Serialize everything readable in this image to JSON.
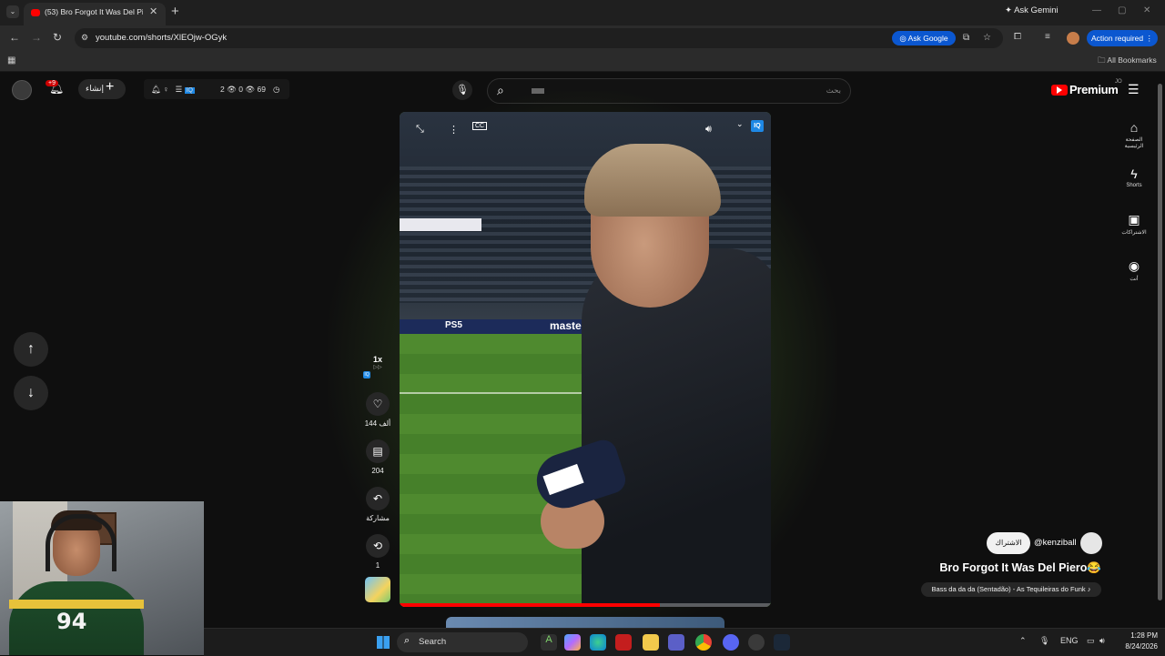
{
  "browser": {
    "tab_title": "(53) Bro Forgot It Was Del Piero",
    "ask_gemini": "Ask Gemini",
    "url": "youtube.com/shorts/XlEOjw-OGyk",
    "ask_google": "Ask Google",
    "action_required": "Action required",
    "all_bookmarks": "All Bookmarks"
  },
  "yt_header": {
    "create_label": "إنشاء",
    "notification_badge": "+9",
    "ext_counts": "2 👁 0 👁 69",
    "search_placeholder": "بحث",
    "premium": "Premium",
    "premium_region": "JO"
  },
  "side_nav": [
    {
      "icon": "home-icon",
      "label": "الصفحة الرئيسية"
    },
    {
      "icon": "shorts-icon",
      "label": "Shorts"
    },
    {
      "icon": "subscriptions-icon",
      "label": "الاشتراكات"
    },
    {
      "icon": "you-icon",
      "label": "أنت"
    }
  ],
  "video_overlay": {
    "billboard_1": "PS5",
    "billboard_2": "mastercard",
    "iq_label": "IQ",
    "progress": 0.7
  },
  "actions": {
    "speed": "1x",
    "likes": "144 ألف",
    "comments": "204",
    "share": "مشاركة",
    "remix": "1"
  },
  "short": {
    "subscribe": "الاشتراك",
    "channel": "@kenziball",
    "title": "Bro Forgot It Was Del Piero😂",
    "sound": "Bass da da da (Sentadão) - As Tequileiras do Funk ♪"
  },
  "webcam": {
    "jersey_number": "94"
  },
  "taskbar": {
    "search": "Search",
    "lang": "ENG",
    "time": "1:28 PM",
    "date": "8/24/2026"
  }
}
